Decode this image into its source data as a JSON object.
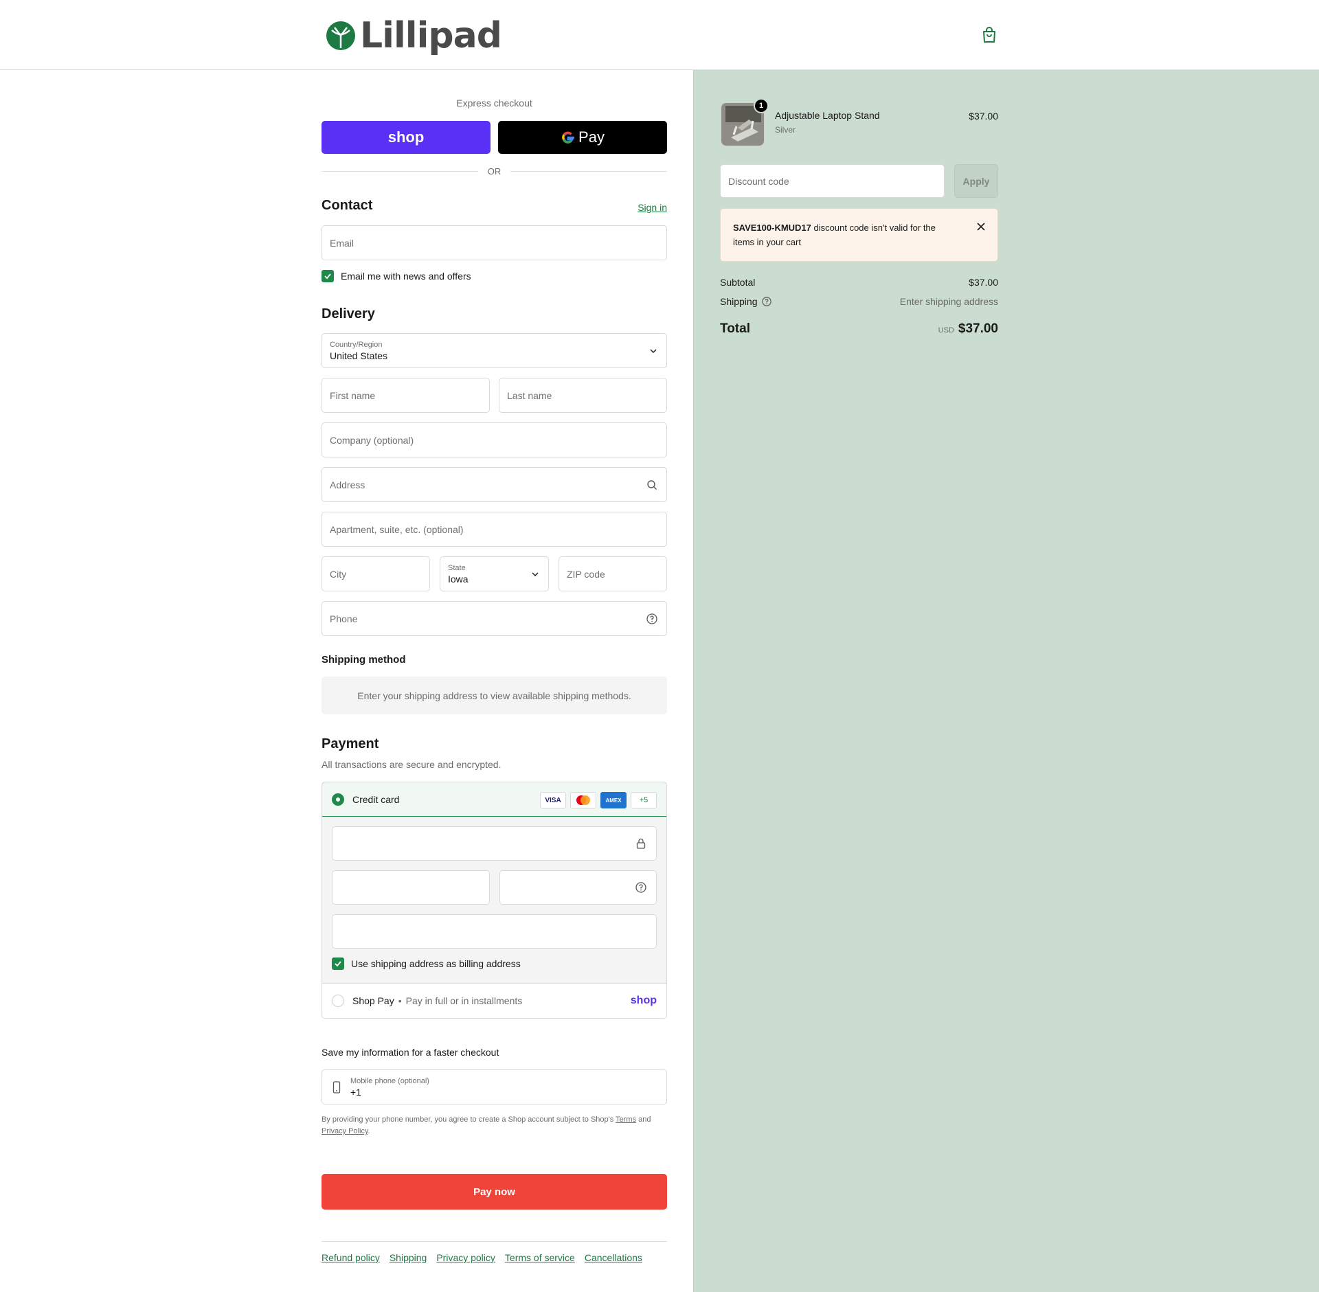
{
  "brand": {
    "name": "Lillipad",
    "accent": "#1e8a49",
    "shop_purple": "#5a31f4",
    "pay_red": "#f04438"
  },
  "header": {
    "cart_icon": "shopping-bag-icon"
  },
  "express": {
    "label": "Express checkout",
    "shop_label": "shop",
    "gpay_label": "Pay",
    "or": "OR"
  },
  "contact": {
    "title": "Contact",
    "sign_in": "Sign in",
    "email_placeholder": "Email",
    "newsletter": "Email me with news and offers"
  },
  "delivery": {
    "title": "Delivery",
    "country_label": "Country/Region",
    "country_value": "United States",
    "first_name": "First name",
    "last_name": "Last name",
    "company": "Company (optional)",
    "address": "Address",
    "apartment": "Apartment, suite, etc. (optional)",
    "city": "City",
    "state_label": "State",
    "state_value": "Iowa",
    "zip": "ZIP code",
    "phone": "Phone"
  },
  "shipping_method": {
    "title": "Shipping method",
    "message": "Enter your shipping address to view available shipping methods."
  },
  "payment": {
    "title": "Payment",
    "subtitle": "All transactions are secure and encrypted.",
    "credit_card": "Credit card",
    "cards": [
      "VISA",
      "MC",
      "AMEX",
      "+5"
    ],
    "billing_same": "Use shipping address as billing address",
    "shop_pay": "Shop Pay",
    "shop_pay_sub": "Pay in full or in installments",
    "shop_logo": "shop"
  },
  "save_info": {
    "title": "Save my information for a faster checkout",
    "mobile_label": "Mobile phone (optional)",
    "mobile_value": "+1",
    "legal_1": "By providing your phone number, you agree to create a Shop account subject to Shop's",
    "terms": "Terms",
    "and": "and",
    "privacy": "Privacy Policy",
    "period": "."
  },
  "pay_now": "Pay now",
  "footer": [
    "Refund policy",
    "Shipping",
    "Privacy policy",
    "Terms of service",
    "Cancellations"
  ],
  "summary": {
    "product_name": "Adjustable Laptop Stand",
    "product_variant": "Silver",
    "product_price": "$37.00",
    "quantity": "1",
    "discount_placeholder": "Discount code",
    "apply": "Apply",
    "alert_code": "SAVE100-KMUD17",
    "alert_text_1": " discount code isn't valid for the",
    "alert_text_2": "items in your cart",
    "subtotal_label": "Subtotal",
    "subtotal_value": "$37.00",
    "shipping_label": "Shipping",
    "shipping_value": "Enter shipping address",
    "total_label": "Total",
    "currency": "USD",
    "total_value": "$37.00"
  }
}
